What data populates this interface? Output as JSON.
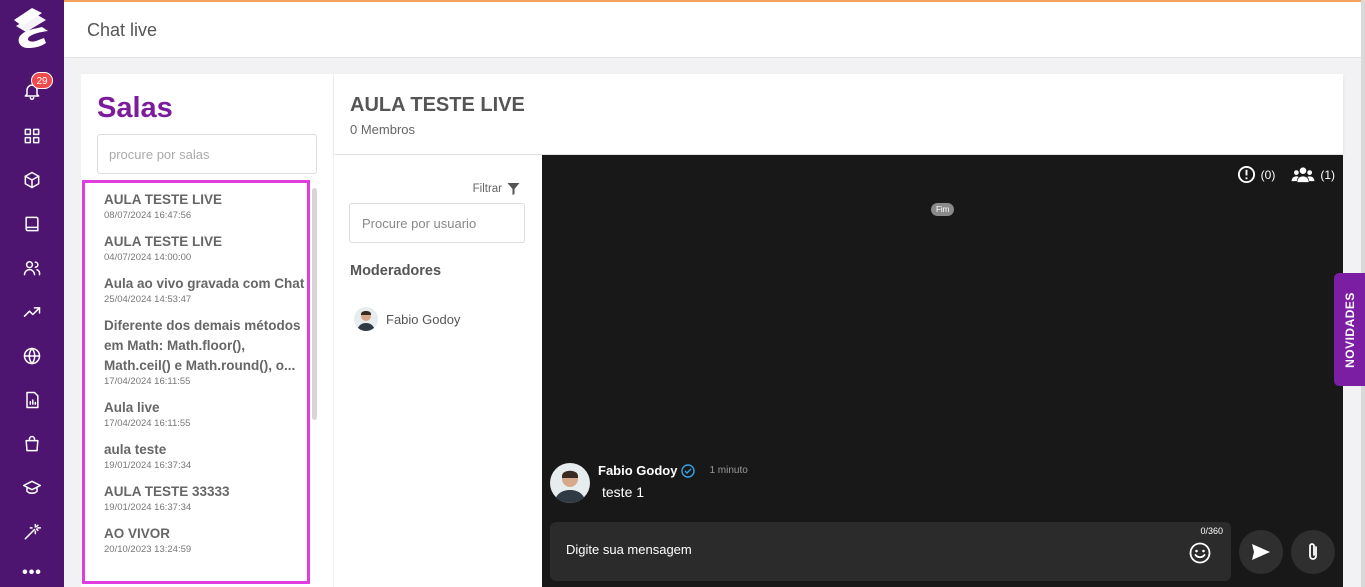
{
  "app": {
    "page_title": "Chat live"
  },
  "nav": {
    "notification_count": "29",
    "icons": [
      "logo",
      "bell-icon",
      "grid-icon",
      "box-icon",
      "book-icon",
      "users-icon",
      "trending-icon",
      "globe-icon",
      "report-icon",
      "bag-icon",
      "graduation-icon",
      "wand-icon",
      "more-icon"
    ]
  },
  "rooms": {
    "title": "Salas",
    "search_placeholder": "procure por salas",
    "items": [
      {
        "name": "AULA TESTE LIVE",
        "date": "08/07/2024 16:47:56"
      },
      {
        "name": "AULA TESTE LIVE",
        "date": "04/07/2024 14:00:00"
      },
      {
        "name": "Aula ao vivo gravada com Chat",
        "date": "25/04/2024 14:53:47"
      },
      {
        "name": "Diferente dos demais métodos em Math: Math.floor(), Math.ceil() e Math.round(), o...",
        "date": "17/04/2024 16:11:55"
      },
      {
        "name": "Aula live",
        "date": "17/04/2024 16:11:55"
      },
      {
        "name": "aula teste",
        "date": "19/01/2024 16:37:34"
      },
      {
        "name": "AULA TESTE 33333",
        "date": "19/01/2024 16:37:34"
      },
      {
        "name": "AO VIVOR",
        "date": "20/10/2023 13:24:59"
      }
    ]
  },
  "chat": {
    "room_title": "AULA TESTE LIVE",
    "members": "0 Membros",
    "reports_count": "(0)",
    "participants_count": "(1)",
    "end_label": "Fim",
    "message": {
      "author": "Fabio Godoy",
      "time": "1 minuto",
      "text": "teste 1"
    },
    "composer_placeholder": "Digite sua mensagem",
    "char_counter": "0/360"
  },
  "users": {
    "filter_label": "Filtrar",
    "search_placeholder": "Procure por usuario",
    "moderators_title": "Moderadores",
    "moderators": [
      {
        "name": "Fabio Godoy"
      }
    ]
  },
  "novidades_label": "NOVIDADES",
  "colors": {
    "nav_bg": "#4e1570",
    "accent_purple": "#7b1c9c",
    "highlight_border": "#e03de0",
    "chat_bg": "#181818",
    "badge_red": "#f24a4a"
  }
}
